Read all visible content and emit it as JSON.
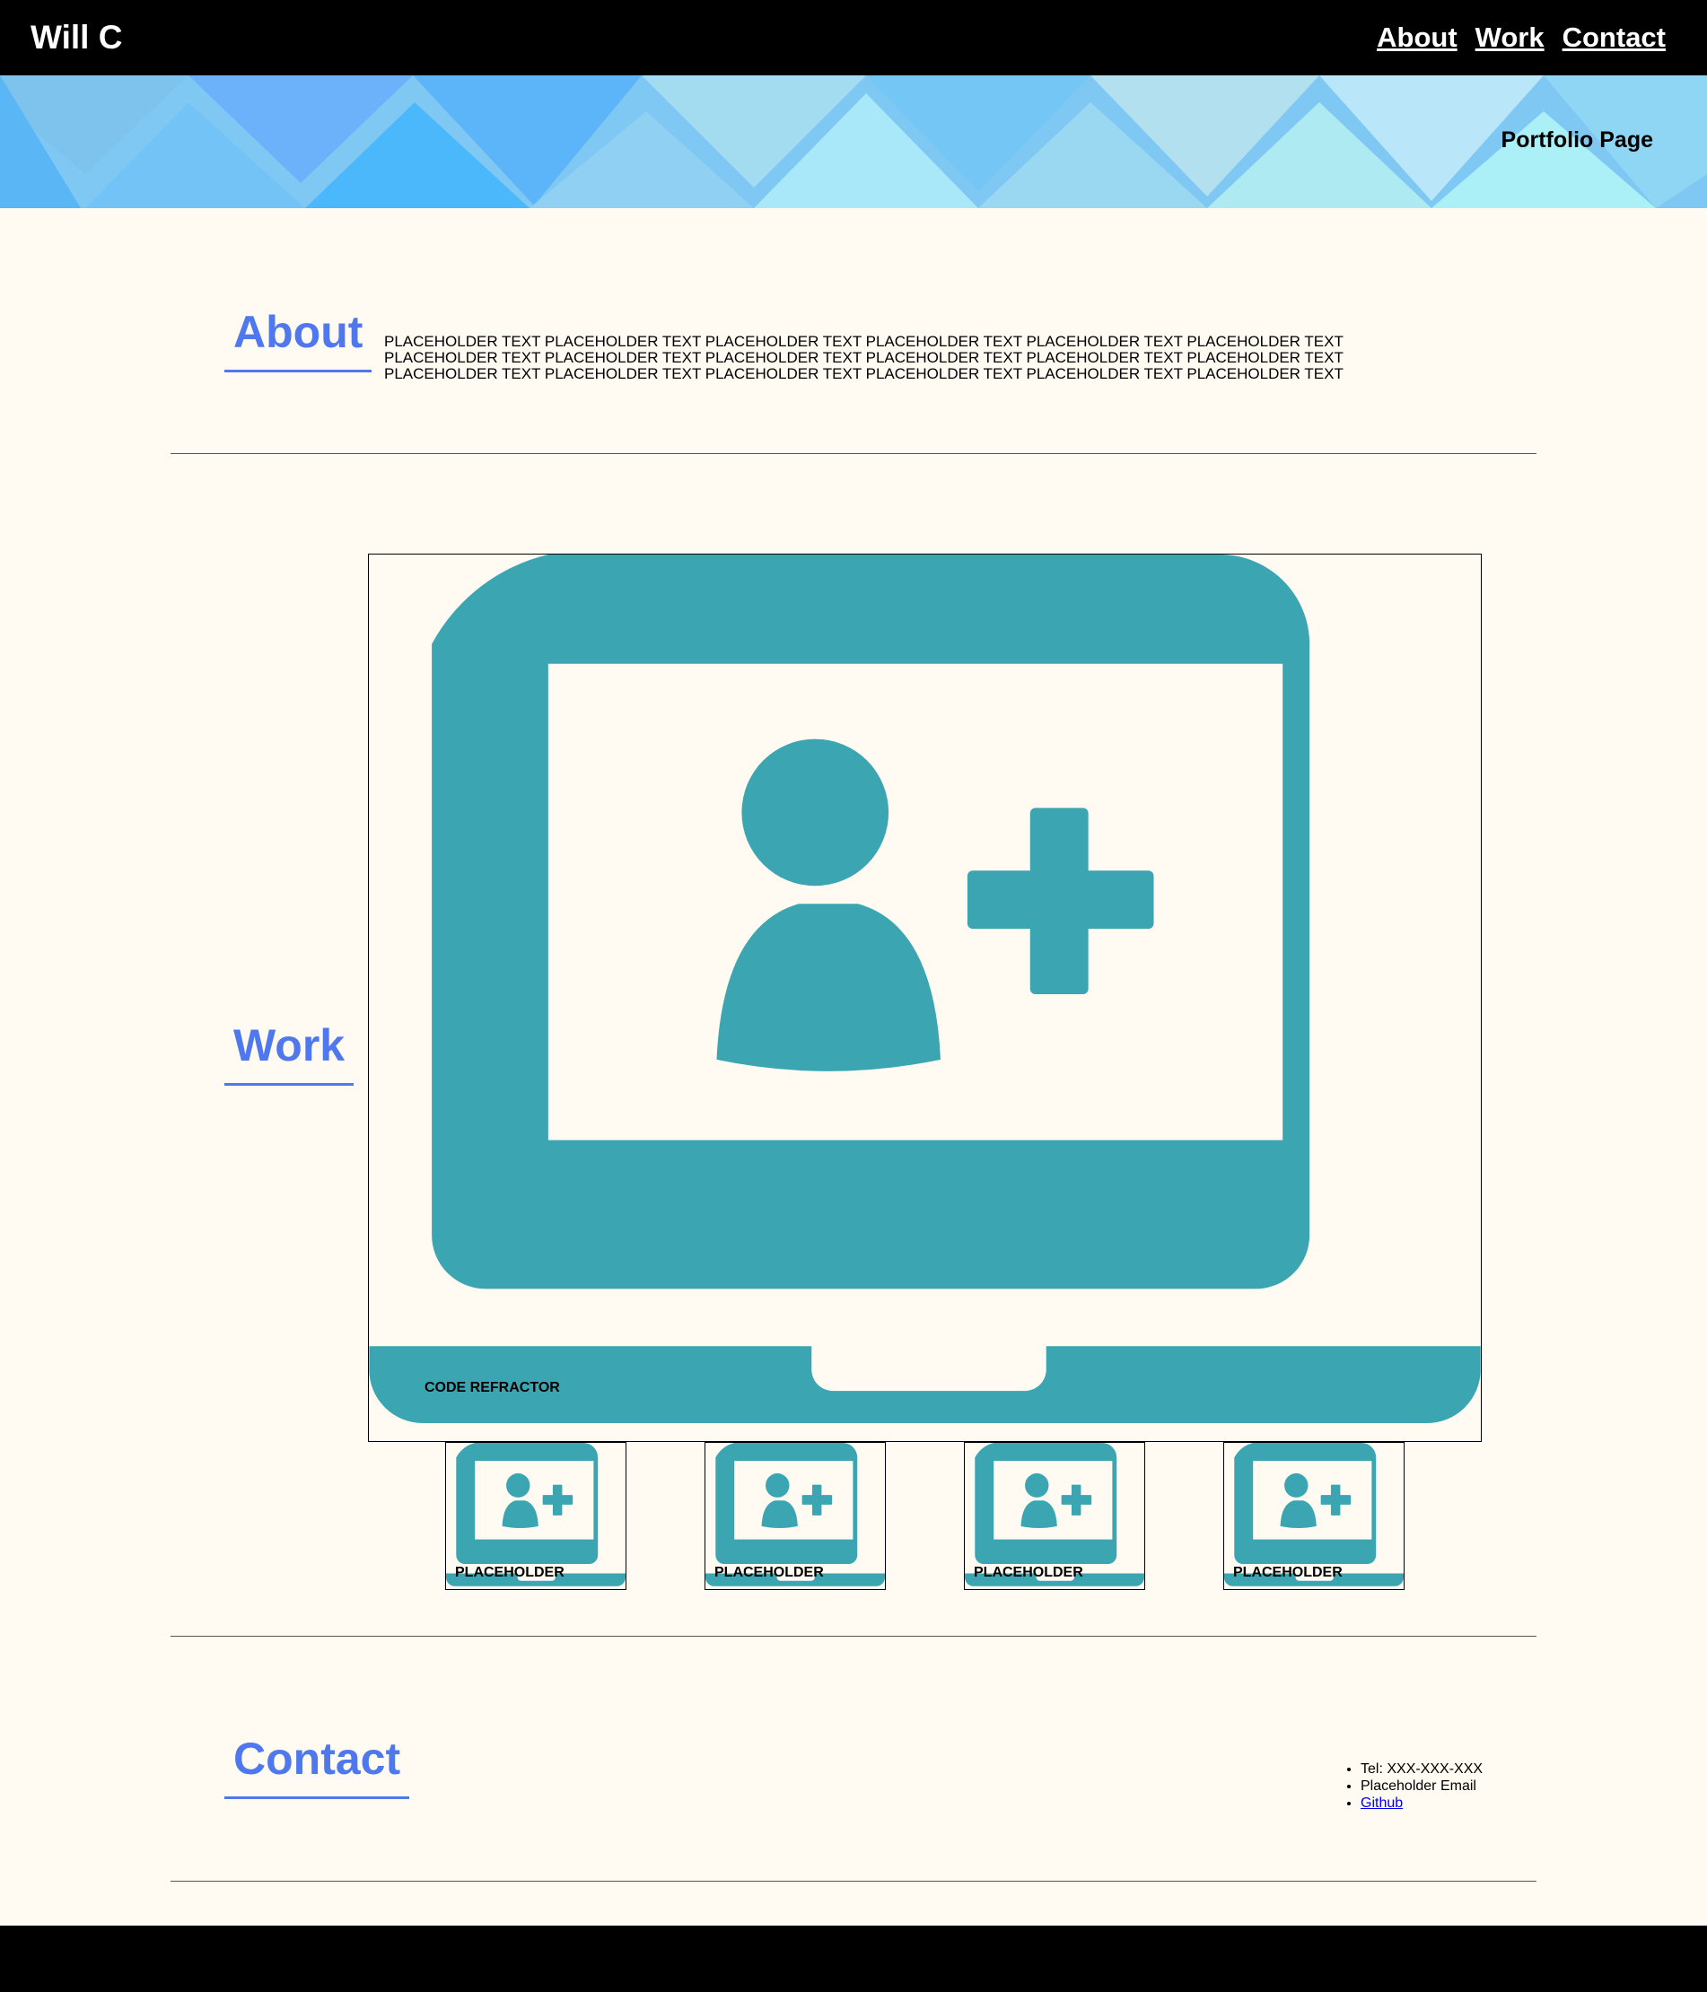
{
  "header": {
    "brand": "Will C",
    "nav": [
      {
        "label": "About"
      },
      {
        "label": "Work"
      },
      {
        "label": "Contact"
      }
    ]
  },
  "banner": {
    "subtitle": "Portfolio Page"
  },
  "about": {
    "heading": "About",
    "text": "PLACEHOLDER TEXT PLACEHOLDER TEXT PLACEHOLDER TEXT PLACEHOLDER TEXT PLACEHOLDER TEXT PLACEHOLDER TEXT PLACEHOLDER TEXT PLACEHOLDER TEXT PLACEHOLDER TEXT PLACEHOLDER TEXT PLACEHOLDER TEXT PLACEHOLDER TEXT PLACEHOLDER TEXT PLACEHOLDER TEXT PLACEHOLDER TEXT PLACEHOLDER TEXT PLACEHOLDER TEXT PLACEHOLDER TEXT"
  },
  "work": {
    "heading": "Work",
    "featured": {
      "label": "CODE REFRACTOR",
      "icon": "laptop-add-user-icon"
    },
    "thumbnails": [
      {
        "label": "PLACEHOLDER",
        "icon": "laptop-add-user-icon"
      },
      {
        "label": "PLACEHOLDER",
        "icon": "laptop-add-user-icon"
      },
      {
        "label": "PLACEHOLDER",
        "icon": "laptop-add-user-icon"
      },
      {
        "label": "PLACEHOLDER",
        "icon": "laptop-add-user-icon"
      }
    ]
  },
  "contact": {
    "heading": "Contact",
    "items": [
      {
        "text": "Tel: XXX-XXX-XXX"
      },
      {
        "text": "Placeholder Email"
      },
      {
        "text": "Github"
      }
    ]
  },
  "colors": {
    "accent": "#5078ee",
    "icon": "#3ba6b2",
    "background": "#fffaf2",
    "bar": "#000000"
  }
}
